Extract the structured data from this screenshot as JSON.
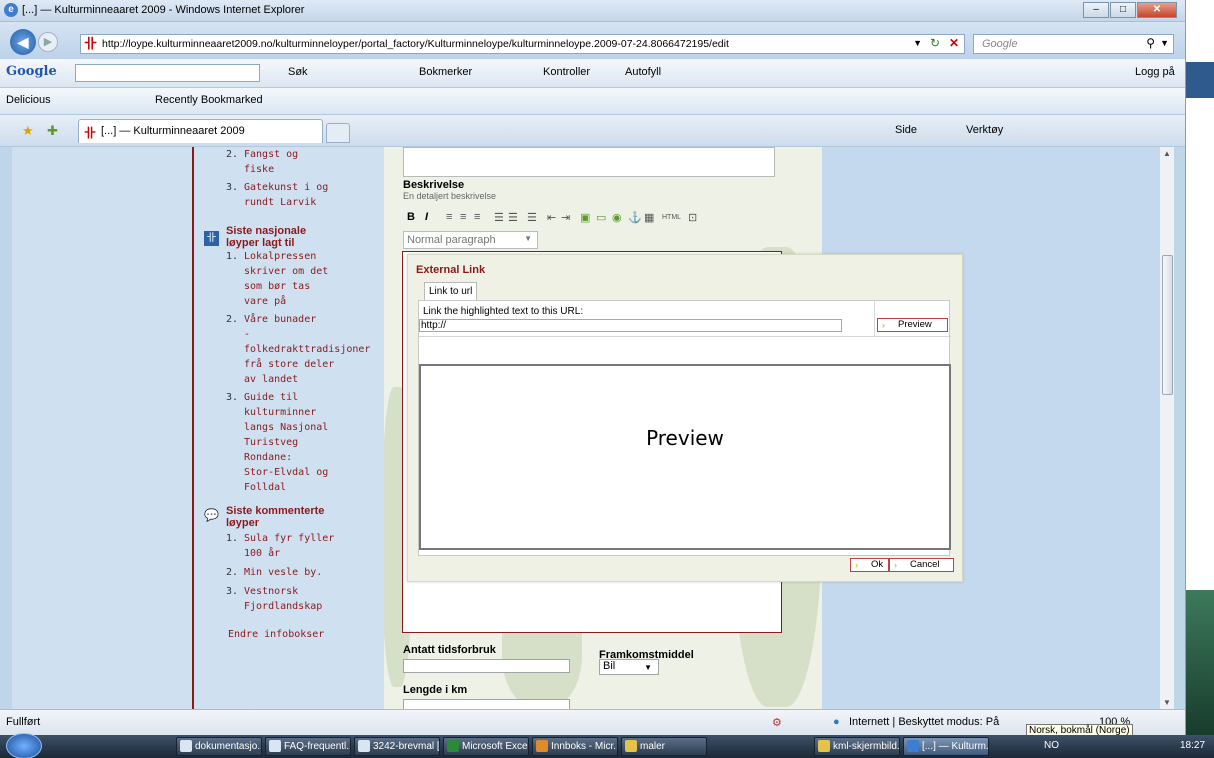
{
  "window": {
    "title": "[...] — Kulturminneaaret 2009 - Windows Internet Explorer"
  },
  "address_bar": {
    "url": "http://loype.kulturminneaaret2009.no/kulturminneloyper/portal_factory/Kulturminneloype/kulturminneloype.2009-07-24.8066472195/edit",
    "search_placeholder": "Google"
  },
  "google_toolbar": {
    "logo": "Google",
    "items": [
      "Søk",
      "Bokmerker",
      "Kontroller",
      "Autofyll"
    ],
    "login": "Logg på"
  },
  "delicious_toolbar": {
    "label": "Delicious",
    "recent": "Recently Bookmarked"
  },
  "tabs": {
    "active_tab": "[...] — Kulturminneaaret 2009",
    "command_items": [
      "Side",
      "Verktøy"
    ]
  },
  "sidebar": {
    "top_list": [
      {
        "n": "2.",
        "lines": [
          "Fangst og",
          "fiske"
        ]
      },
      {
        "n": "3.",
        "lines": [
          "Gatekunst i og",
          "rundt Larvik"
        ]
      }
    ],
    "section1_title": [
      "Siste nasjonale",
      "løyper lagt til"
    ],
    "section1_list": [
      {
        "n": "1.",
        "lines": [
          "Lokalpressen",
          "skriver om det",
          "som bør tas",
          "vare på"
        ]
      },
      {
        "n": "2.",
        "lines": [
          "Våre bunader",
          "-",
          "folkedrakttradisjoner",
          "frå store deler",
          "av landet"
        ]
      },
      {
        "n": "3.",
        "lines": [
          "Guide til",
          "kulturminner",
          "langs Nasjonal",
          "Turistveg",
          "Rondane:",
          "Stor-Elvdal og",
          "Folldal"
        ]
      }
    ],
    "section2_title": [
      "Siste kommenterte",
      "løyper"
    ],
    "section2_list": [
      {
        "n": "1.",
        "lines": [
          "Sula fyr fyller",
          "100 år"
        ]
      },
      {
        "n": "2.",
        "lines": [
          "Min vesle by."
        ]
      },
      {
        "n": "3.",
        "lines": [
          "Vestnorsk",
          "Fjordlandskap"
        ]
      }
    ],
    "edit_link": "Endre infobokser"
  },
  "form": {
    "description_label": "Beskrivelse",
    "description_help": "En detaljert beskrivelse",
    "paragraph_style": "Normal paragraph",
    "time_label": "Antatt tidsforbruk",
    "transport_label": "Framkomstmiddel",
    "transport_value": "Bil",
    "length_label": "Lengde i km"
  },
  "dialog": {
    "title": "External Link",
    "tab": "Link to url",
    "instruction": "Link the highlighted text to this URL:",
    "url_value": "http://",
    "preview_button": "Preview",
    "preview_text": "Preview",
    "ok_button": "Ok",
    "cancel_button": "Cancel"
  },
  "statusbar": {
    "status": "Fullført",
    "zone": "Internett | Beskyttet modus: På",
    "zoom": "100 %",
    "tooltip": "Norsk, bokmål (Norge)"
  },
  "taskbar": {
    "buttons": [
      "dokumentasjo...",
      "FAQ-frequentl...",
      "3242-brevmal [...",
      "Microsoft Excel",
      "Innboks - Micr...",
      "maler",
      "kml-skjermbild...",
      "[...] — Kulturm..."
    ],
    "lang": "NO",
    "time": "18:27"
  }
}
